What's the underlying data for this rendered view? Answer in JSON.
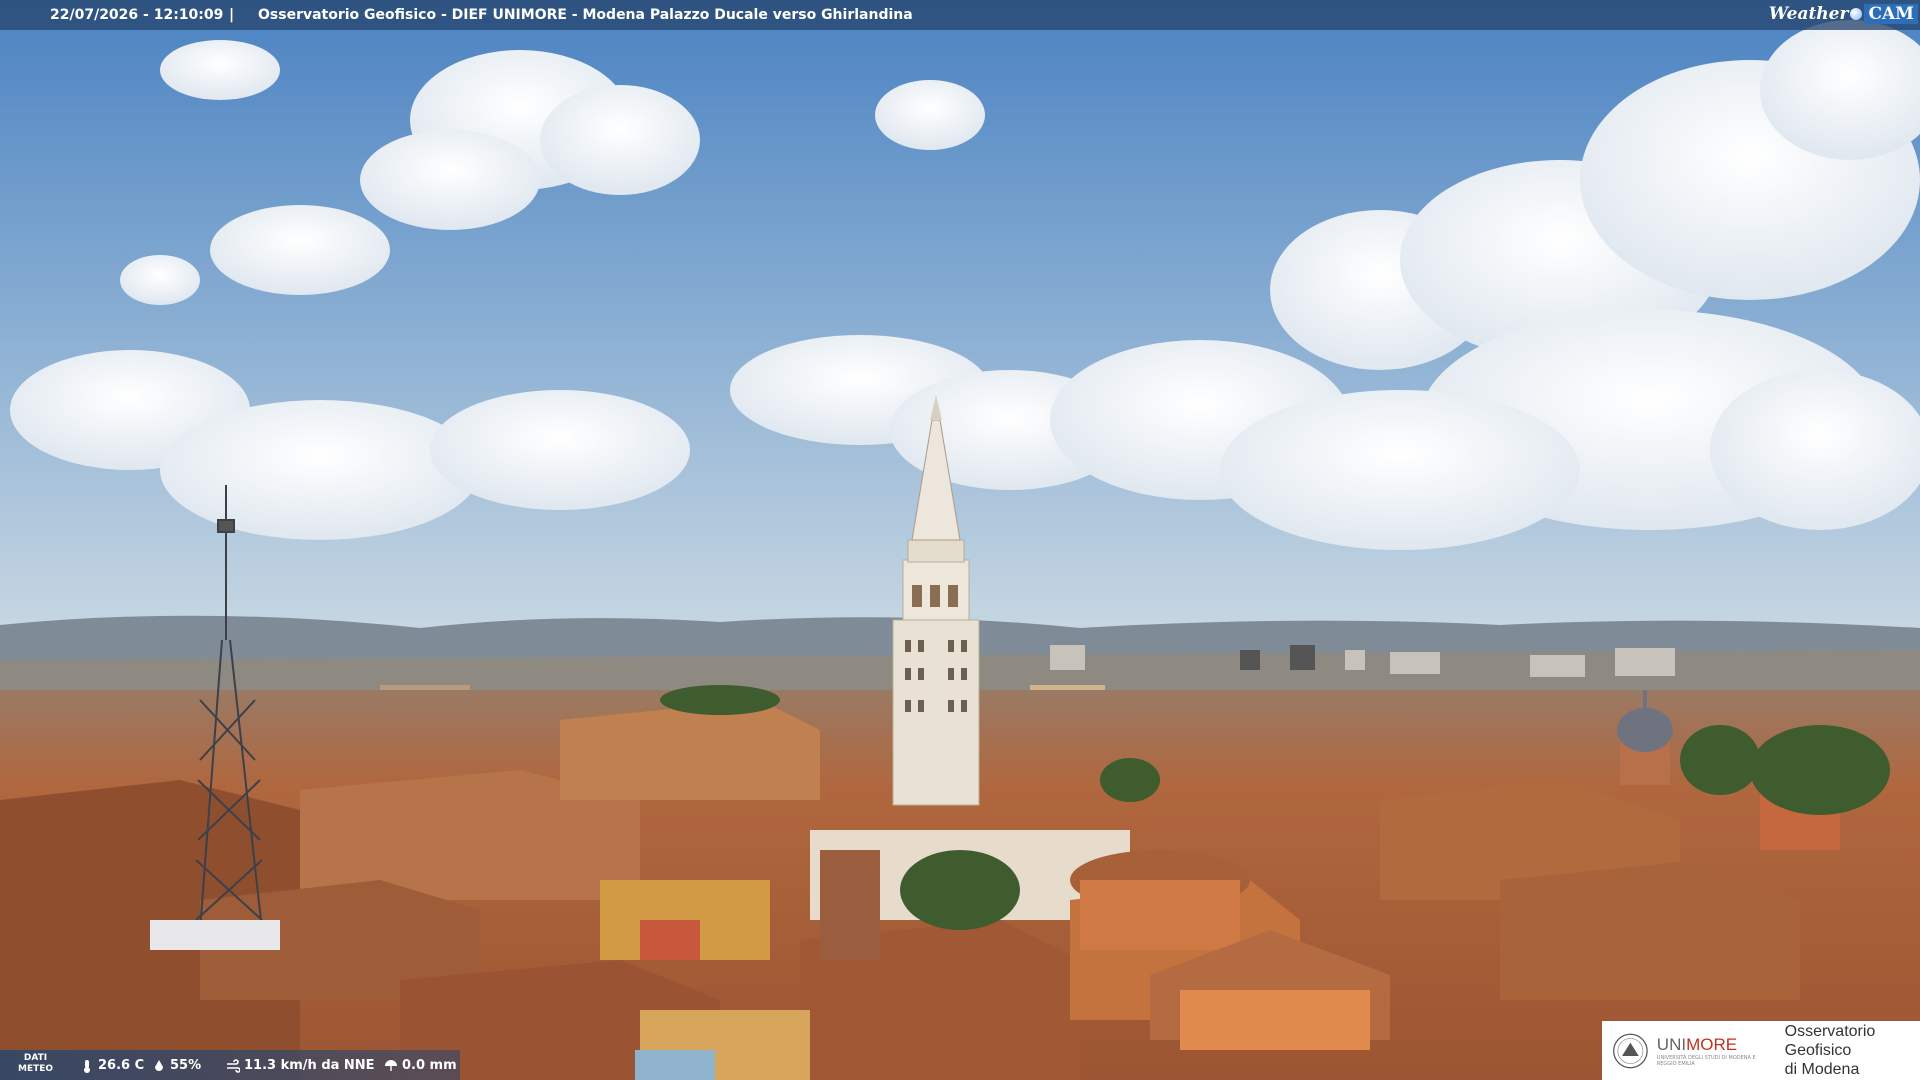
{
  "overlay": {
    "timestamp": "22/07/2026 - 12:10:09",
    "separator": "|",
    "title": "Osservatorio Geofisico - DIEF UNIMORE - Modena Palazzo Ducale verso Ghirlandina",
    "logo": {
      "weather": "Weather",
      "cam": "CAM"
    }
  },
  "weather_data": {
    "label_line1": "DATI",
    "label_line2": "METEO",
    "temperature": "26.6 C",
    "humidity": "55%",
    "wind": "11.3 km/h da NNE",
    "rain": "0.0 mm"
  },
  "branding": {
    "uni_prefix": "UNI",
    "uni_suffix": "MORE",
    "uni_sub": "UNIVERSITÀ DEGLI STUDI DI MODENA E REGGIO EMILIA",
    "observatory_line1": "Osservatorio Geofisico",
    "observatory_line2": "di Modena"
  },
  "colors": {
    "sky_top": "#4f86c4",
    "sky_bottom": "#b9cfe0",
    "roofs": "#a8613a",
    "tower": "#e9e2d6",
    "accent": "#c2321e"
  }
}
